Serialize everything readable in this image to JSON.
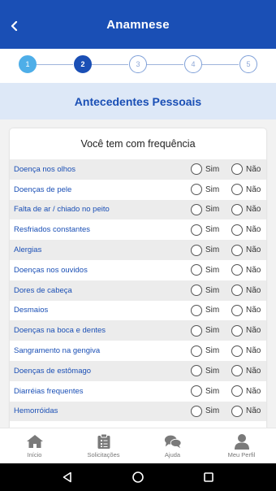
{
  "header": {
    "title": "Anamnese",
    "back_icon": "chevron-left-icon"
  },
  "stepper": {
    "steps": [
      {
        "label": "1",
        "state": "done"
      },
      {
        "label": "2",
        "state": "active"
      },
      {
        "label": "3",
        "state": "pending"
      },
      {
        "label": "4",
        "state": "pending"
      },
      {
        "label": "5",
        "state": "pending"
      }
    ],
    "colors": {
      "done": "#4eaee8",
      "active": "#1a4fb5",
      "pending": "#7fa0d8"
    }
  },
  "section": {
    "title": "Antecedentes Pessoais"
  },
  "card": {
    "title": "Você tem com frequência",
    "options": {
      "yes": "Sim",
      "no": "Não"
    },
    "questions": [
      "Doença nos olhos",
      "Doenças de pele",
      "Falta de ar / chiado no peito",
      "Resfriados constantes",
      "Alergias",
      "Doenças nos ouvidos",
      "Dores de cabeça",
      "Desmaios",
      "Doenças na boca e dentes",
      "Sangramento na gengiva",
      "Doenças de estômago",
      "Diarréias frequentes",
      "Hemorróidas"
    ]
  },
  "bottom_nav": {
    "items": [
      {
        "label": "Início",
        "icon": "home-icon"
      },
      {
        "label": "Solicitações",
        "icon": "clipboard-icon"
      },
      {
        "label": "Ajuda",
        "icon": "chat-bubbles-icon"
      },
      {
        "label": "Meu Perfil",
        "icon": "user-icon"
      }
    ]
  },
  "system_nav": {
    "icons": [
      "back-triangle-icon",
      "home-circle-icon",
      "recents-square-icon"
    ]
  },
  "colors": {
    "primary": "#1a4fb5",
    "banner_bg": "#dde8f7",
    "row_shade": "#ececec"
  }
}
